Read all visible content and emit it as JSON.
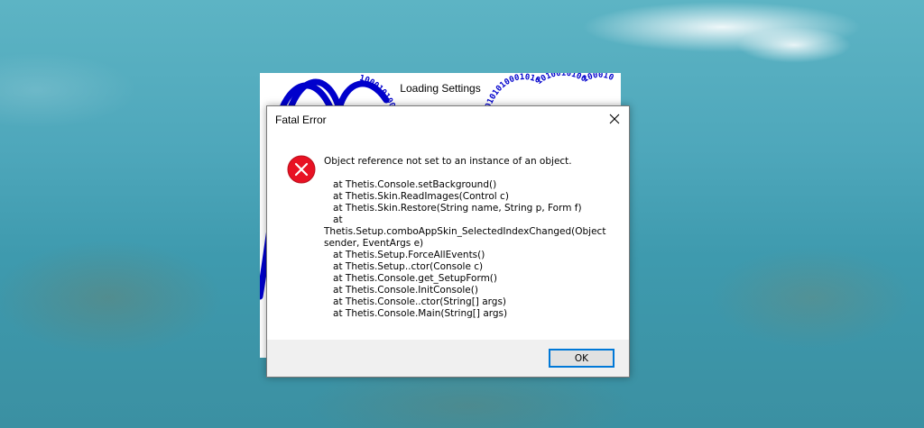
{
  "splash": {
    "title": "Loading Settings",
    "binary_left": "1000101000101",
    "binary_right": "01010100010101010010100100010"
  },
  "dialog": {
    "title": "Fatal Error",
    "message": "Object reference not set to an instance of an object.",
    "stack_trace": "   at Thetis.Console.setBackground()\n   at Thetis.Skin.ReadImages(Control c)\n   at Thetis.Skin.Restore(String name, String p, Form f)\n   at\nThetis.Setup.comboAppSkin_SelectedIndexChanged(Object\nsender, EventArgs e)\n   at Thetis.Setup.ForceAllEvents()\n   at Thetis.Setup..ctor(Console c)\n   at Thetis.Console.get_SetupForm()\n   at Thetis.Console.InitConsole()\n   at Thetis.Console..ctor(String[] args)\n   at Thetis.Console.Main(String[] args)",
    "ok_label": "OK",
    "icon": "error-icon",
    "close_icon": "close-icon"
  },
  "colors": {
    "error_red": "#e81123",
    "accent_blue": "#0078d7",
    "splash_wave": "#0000cc"
  }
}
